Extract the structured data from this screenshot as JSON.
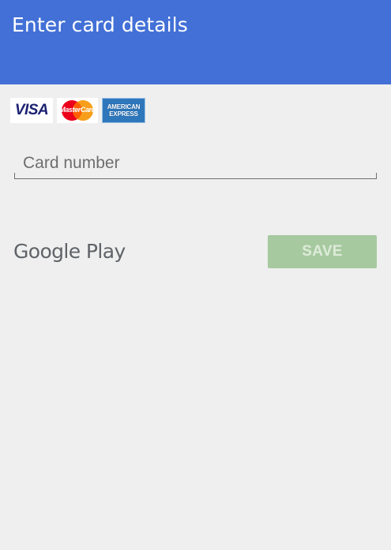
{
  "header": {
    "title": "Enter card details",
    "color": "#4270d6"
  },
  "card_brands": [
    {
      "name": "visa",
      "label": "VISA"
    },
    {
      "name": "mastercard",
      "label": "MasterCard"
    },
    {
      "name": "amex",
      "label_line1": "AMERICAN",
      "label_line2": "EXPRESS"
    }
  ],
  "card_number": {
    "placeholder": "Card number",
    "value": ""
  },
  "footer": {
    "provider_label": "Google Play",
    "save_label": "SAVE",
    "save_color": "#a7c9a0",
    "save_enabled": false
  }
}
